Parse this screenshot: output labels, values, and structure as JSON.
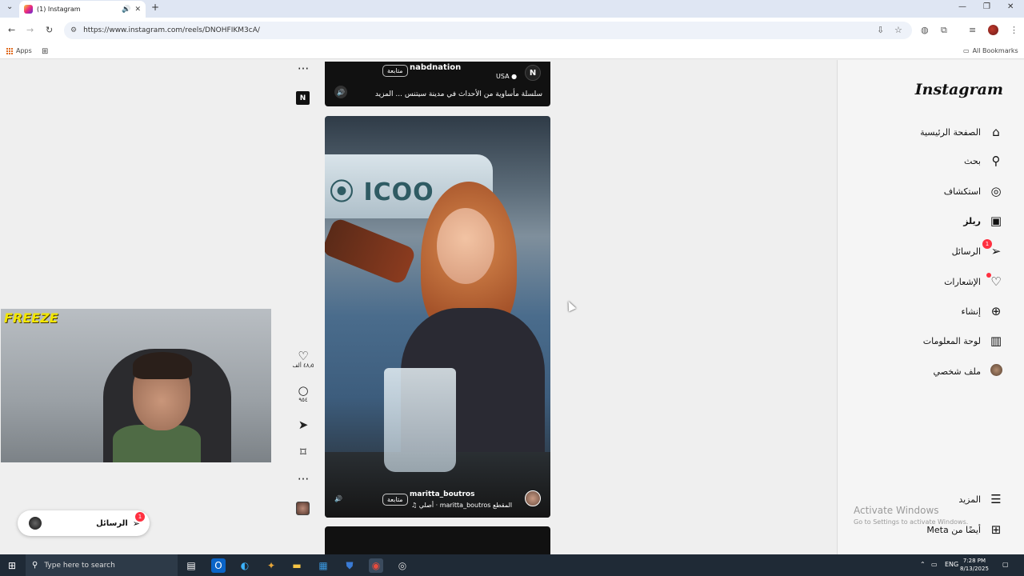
{
  "browser": {
    "tab_title": "(1) Instagram",
    "url": "https://www.instagram.com/reels/DNOHFIKM3cA/",
    "bookmarks": {
      "apps": "Apps",
      "all": "All Bookmarks"
    }
  },
  "reel_top": {
    "username": "nabdnation",
    "follow": "متابعة",
    "location": "USA",
    "logo_letter": "N",
    "caption": "سلسلة مأساوية من الأحداث في مدينة سيتنس ... المزيد"
  },
  "reel_main": {
    "sign_text": "⦿ ICOO",
    "username": "maritta_boutros",
    "follow": "متابعة",
    "audio": "♫ أصلي · maritta_boutros المقطع"
  },
  "actions": {
    "likes": "٤٨٫٥ ألف",
    "comments": "٩٥٤"
  },
  "sidebar": {
    "logo": "Instagram",
    "items": [
      {
        "label": "الصفحة الرئيسية",
        "icon": "home-icon"
      },
      {
        "label": "بحث",
        "icon": "search-icon"
      },
      {
        "label": "استكشاف",
        "icon": "compass-icon"
      },
      {
        "label": "ريلز",
        "icon": "reels-icon"
      },
      {
        "label": "الرسائل",
        "icon": "messages-icon",
        "badge": "1"
      },
      {
        "label": "الإشعارات",
        "icon": "heart-icon"
      },
      {
        "label": "إنشاء",
        "icon": "plus-icon"
      },
      {
        "label": "لوحة المعلومات",
        "icon": "dashboard-icon"
      },
      {
        "label": "ملف شخصي",
        "icon": "profile-icon"
      }
    ],
    "more": "المزيد",
    "also_meta": "أيضًا من Meta"
  },
  "watermark": {
    "line1": "Activate Windows",
    "line2": "Go to Settings to activate Windows."
  },
  "overlay": {
    "cam_label": "FREEZE",
    "messages_label": "الرسائل",
    "messages_badge": "1"
  },
  "taskbar": {
    "search_placeholder": "Type here to search",
    "lang": "ENG",
    "time": "7:28 PM",
    "date": "8/13/2025"
  }
}
